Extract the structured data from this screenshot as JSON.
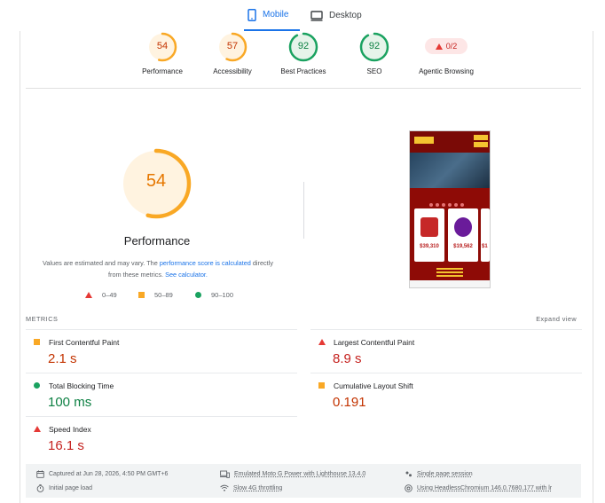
{
  "tabs": {
    "mobile": "Mobile",
    "desktop": "Desktop"
  },
  "gauges": [
    {
      "value": "54",
      "label": "Performance",
      "score": 54,
      "color": "#f9a825",
      "text_color": "#c33300"
    },
    {
      "value": "57",
      "label": "Accessibility",
      "score": 57,
      "color": "#f9a825",
      "text_color": "#c33300"
    },
    {
      "value": "92",
      "label": "Best Practices",
      "score": 92,
      "color": "#1aa260",
      "text_color": "#0d8043"
    },
    {
      "value": "92",
      "label": "SEO",
      "score": 92,
      "color": "#1aa260",
      "text_color": "#0d8043"
    }
  ],
  "agentic": {
    "value": "0/2",
    "label": "Agentic Browsing"
  },
  "performance": {
    "score": "54",
    "score_fraction": 0.54,
    "label": "Performance",
    "note_part1": "Values are estimated and may vary. The ",
    "note_link1": "performance score is calculated",
    "note_part2": " directly from these metrics. ",
    "note_link2": "See calculator."
  },
  "legend": {
    "poor": "0–49",
    "average": "50–89",
    "good": "90–100"
  },
  "thumbnail": {
    "price1": "$39,310",
    "price2": "$19,562",
    "price3": "$1"
  },
  "metrics": {
    "title": "METRICS",
    "expand": "Expand view",
    "fcp": {
      "name": "First Contentful Paint",
      "value": "2.1 s"
    },
    "lcp": {
      "name": "Largest Contentful Paint",
      "value": "8.9 s"
    },
    "tbt": {
      "name": "Total Blocking Time",
      "value": "100 ms"
    },
    "cls": {
      "name": "Cumulative Layout Shift",
      "value": "0.191"
    },
    "si": {
      "name": "Speed Index",
      "value": "16.1 s"
    }
  },
  "footer": {
    "captured": "Captured at Jun 28, 2026, 4:50 PM GMT+6",
    "emulated": "Emulated Moto G Power with Lighthouse 13.4.0",
    "session": "Single page session",
    "initial": "Initial page load",
    "throttling": "Slow 4G throttling",
    "browser": "Using HeadlessChromium 146.0.7680.177 with lr"
  },
  "colors": {
    "accent": "#1a73e8",
    "poor": "#e53935",
    "average": "#f9a825",
    "good": "#1aa260"
  }
}
